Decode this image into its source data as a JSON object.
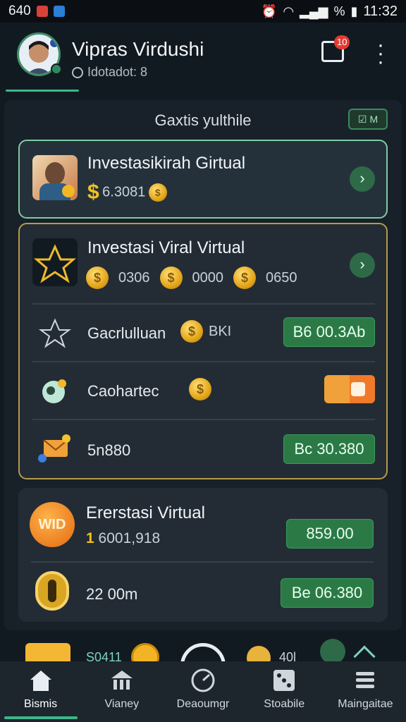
{
  "status_bar": {
    "left_text": "640",
    "icons": [
      "record-icon",
      "app-icon"
    ],
    "right_icons": [
      "alarm-icon",
      "wifi-icon",
      "signal-icon",
      "battery-icon"
    ],
    "right_text": "%",
    "time": "11:32"
  },
  "profile": {
    "name": "Vipras Virdushi",
    "subtitle": "Idotadot: 8",
    "notification_count": "10"
  },
  "panel": {
    "title": "Gaxtis yulthile",
    "toggle_label": "M"
  },
  "card1": {
    "title": "Investasikirah Girtual",
    "currency": "$",
    "value": "6.3081"
  },
  "card2": {
    "title": "Investasi Viral Virtual",
    "coin_values": [
      "0306",
      "0000",
      "0650"
    ],
    "rows": [
      {
        "label": "Gacrlulluan",
        "extra": "BKI",
        "button": "B6 00.3Ab",
        "icon": "network-icon"
      },
      {
        "label": "Caohartec",
        "extra": "",
        "button": "",
        "icon": "palette-icon"
      },
      {
        "label": "5n880",
        "extra": "",
        "button": "Bc 30.380",
        "icon": "mail-icon"
      }
    ]
  },
  "card3": {
    "logo_text": "WID",
    "title": "Ererstasi Virtual",
    "lead": "1",
    "value": "6001,918",
    "button": "859.00",
    "row_label": "22 00m",
    "row_button": "Be 06.380"
  },
  "strip": {
    "left_text": "S0411",
    "right_text": "40l"
  },
  "bottom_nav": [
    {
      "label": "Bismis",
      "icon": "home-icon",
      "active": true
    },
    {
      "label": "Vianey",
      "icon": "bank-icon",
      "active": false
    },
    {
      "label": "Deaoumgr",
      "icon": "gauge-icon",
      "active": false
    },
    {
      "label": "Stoabile",
      "icon": "dice-icon",
      "active": false
    },
    {
      "label": "Maingaitae",
      "icon": "menu-icon",
      "active": false
    }
  ],
  "colors": {
    "accent": "#3bb88a",
    "button_green": "#2b7a46",
    "gold": "#f4c21c",
    "background": "#121a21"
  }
}
